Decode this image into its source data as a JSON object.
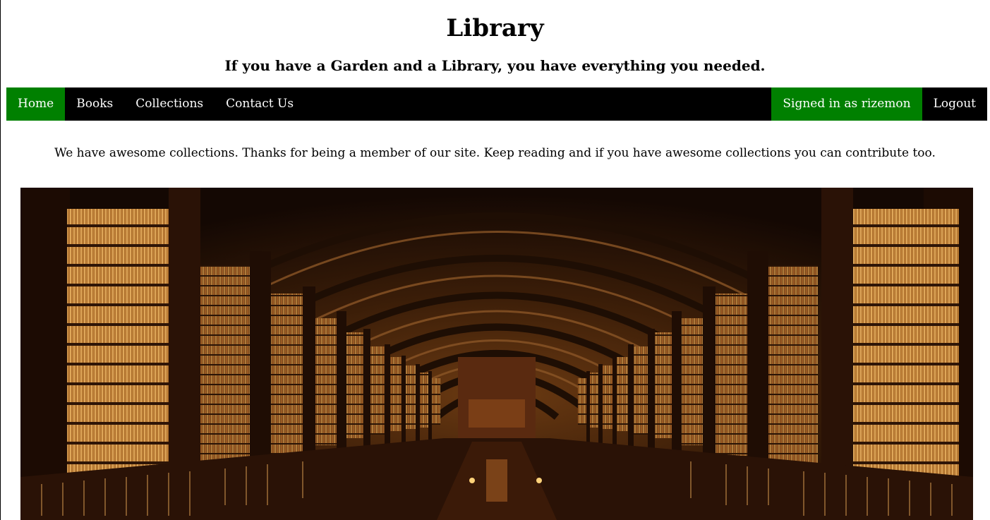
{
  "header": {
    "title": "Library",
    "tagline": "If you have a Garden and a Library, you have everything you needed."
  },
  "nav": {
    "items": [
      {
        "label": "Home",
        "active": true
      },
      {
        "label": "Books",
        "active": false
      },
      {
        "label": "Collections",
        "active": false
      },
      {
        "label": "Contact Us",
        "active": false
      }
    ],
    "signed_in": "Signed in as rizemon",
    "logout": "Logout"
  },
  "main": {
    "intro": "We have awesome collections. Thanks for being a member of our site. Keep reading and if you have awesome collections you can contribute too."
  },
  "colors": {
    "nav_bg": "#000000",
    "accent": "#008000",
    "nav_text": "#ffffff"
  }
}
